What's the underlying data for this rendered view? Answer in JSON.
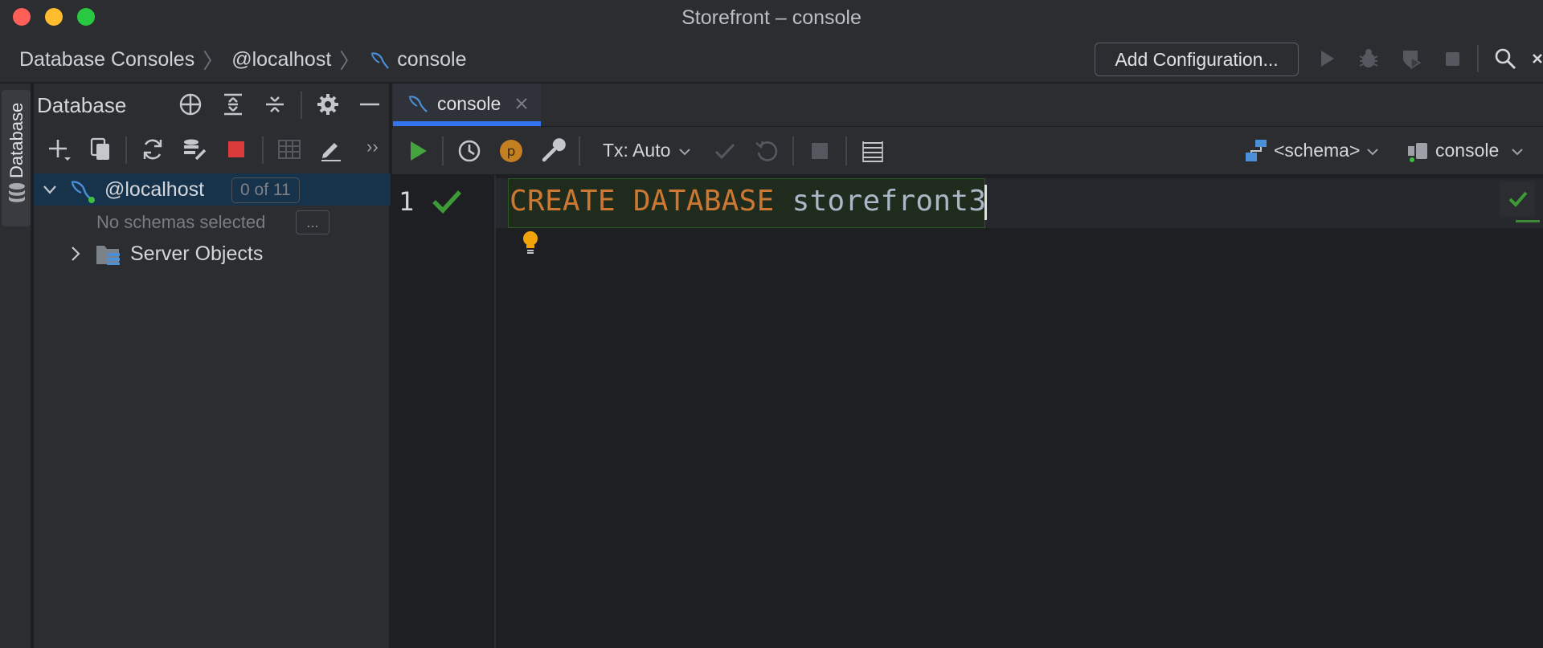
{
  "window": {
    "title": "Storefront – console"
  },
  "breadcrumbs": [
    "Database Consoles",
    "@localhost",
    "console"
  ],
  "run_config": {
    "add_configuration_label": "Add Configuration..."
  },
  "left_strip": {
    "tab_label": "Database"
  },
  "database_panel": {
    "title": "Database",
    "tree": {
      "connection": {
        "label": "@localhost",
        "badge": "0 of 11"
      },
      "no_schemas_text": "No schemas selected",
      "dots_label": "...",
      "server_objects_label": "Server Objects"
    }
  },
  "editor": {
    "tab_label": "console",
    "toolbar": {
      "tx_label": "Tx: Auto",
      "schema_selector": "<schema>",
      "session_selector": "console"
    },
    "line_number": "1",
    "code": {
      "keyword1": "CREATE",
      "keyword2": "DATABASE",
      "identifier": "storefront3"
    }
  },
  "colors": {
    "accent_blue": "#3574f0",
    "keyword_orange": "#cc7832",
    "success_green": "#3d8b37",
    "stop_red": "#db3b3b",
    "run_green": "#45a43f"
  }
}
